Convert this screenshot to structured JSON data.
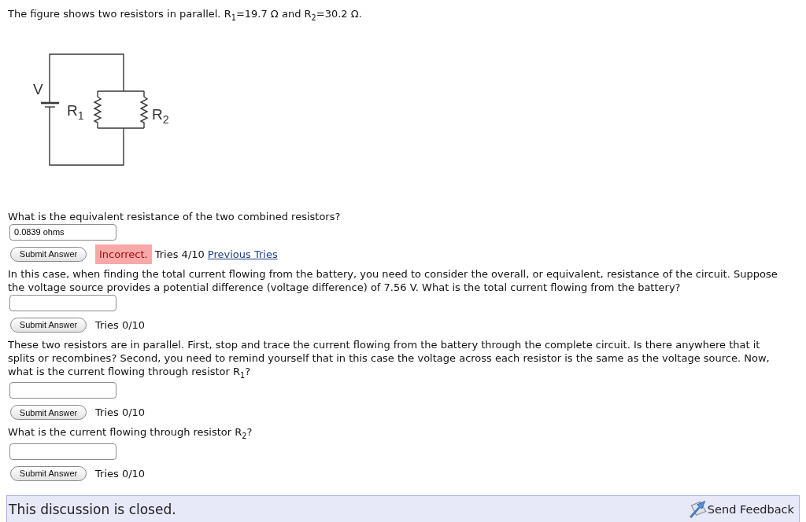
{
  "intro": "The figure shows two resistors in parallel. R$_{1}$=19.7 Ω and R$_{2}$=30.2 Ω.",
  "figure": {
    "labels": [
      {
        "kind": "source",
        "text": "V"
      },
      {
        "kind": "left_resistor",
        "text": "R$_{1}$"
      },
      {
        "kind": "right_resistor",
        "text": "R$_{2}$"
      }
    ]
  },
  "parts": [
    {
      "prompt": "What is the equivalent resistance of the two combined resistors?",
      "answer": "0.0839 ohms",
      "submit": "Submit Answer",
      "feedback": {
        "correct": false,
        "text": "Incorrect."
      },
      "tries": "Tries 4/10",
      "link": "Previous Tries"
    },
    {
      "prompt": "In this case, when finding the total current flowing from the battery, you need to consider the overall, or equivalent, resistance of the circuit. Suppose the voltage source provides a potential difference (voltage difference) of 7.56 V. What is the total current flowing from the battery?",
      "submit": "Submit Answer",
      "tries": "Tries 0/10"
    },
    {
      "prompt": "These two resistors are in parallel. First, stop and trace the current flowing from the battery through the complete circuit. Is there anywhere that it splits or recombines? Second, you need to remind yourself that in this case the voltage across each resistor is the same as the voltage source. Now, what is the current flowing through resistor R$_{1}$?",
      "submit": "Submit Answer",
      "tries": "Tries 0/10"
    },
    {
      "prompt": "What is the current flowing through resistor R$_{2}$?",
      "submit": "Submit Answer",
      "tries": "Tries 0/10"
    }
  ],
  "footer": {
    "message": "This discussion is closed.",
    "link": "Send Feedback"
  }
}
